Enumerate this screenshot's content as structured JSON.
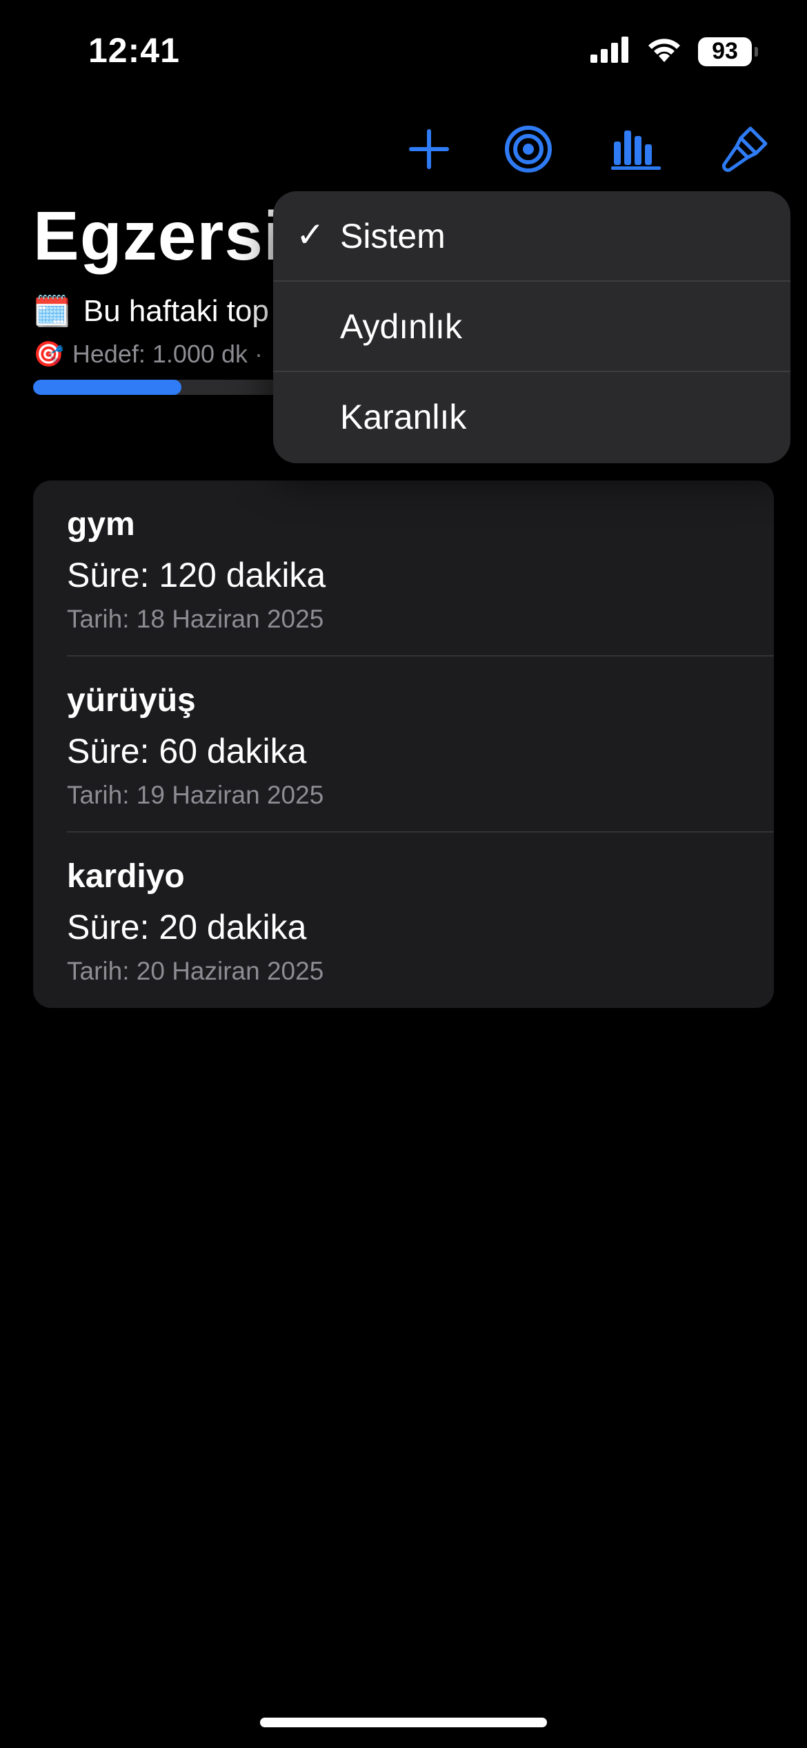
{
  "status_bar": {
    "time": "12:41",
    "battery": "93"
  },
  "toolbar": {
    "add_icon": "plus-icon",
    "goal_icon": "target-icon",
    "stats_icon": "bar-chart-icon",
    "theme_icon": "paintbrush-icon",
    "accent": "#2f7cf6"
  },
  "header": {
    "title": "Egzersi",
    "weekly_emoji": "🗓️",
    "weekly_text": "Bu haftaki top",
    "goal_emoji": "🎯",
    "goal_text": "Hedef: 1.000 dk ·",
    "progress_fraction": 0.2
  },
  "exercises": [
    {
      "name": "gym",
      "duration": "Süre: 120 dakika",
      "date": "Tarih: 18 Haziran 2025"
    },
    {
      "name": "yürüyüş",
      "duration": "Süre: 60 dakika",
      "date": "Tarih: 19 Haziran 2025"
    },
    {
      "name": "kardiyo",
      "duration": "Süre: 20 dakika",
      "date": "Tarih: 20 Haziran 2025"
    }
  ],
  "theme_menu": {
    "checkmark": "✓",
    "items": [
      {
        "label": "Sistem",
        "selected": true
      },
      {
        "label": "Aydınlık",
        "selected": false
      },
      {
        "label": "Karanlık",
        "selected": false
      }
    ]
  }
}
